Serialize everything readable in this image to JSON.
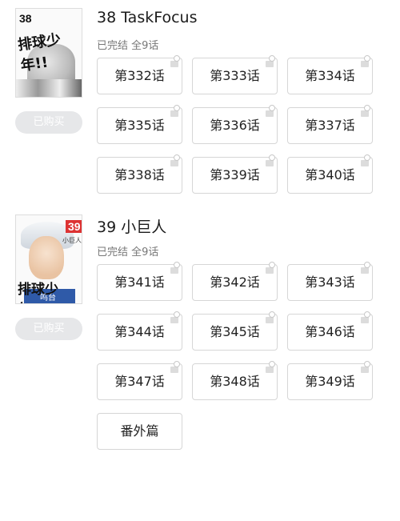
{
  "volumes": [
    {
      "title": "38 TaskFocus",
      "status": "已完结 全9话",
      "badge": "已购买",
      "cover": {
        "number": "38",
        "title_art": "排球少年!!"
      },
      "chapters": [
        "第332话",
        "第333话",
        "第334话",
        "第335话",
        "第336话",
        "第337话",
        "第338话",
        "第339话",
        "第340话"
      ]
    },
    {
      "title": "39 小巨人",
      "status": "已完结 全9话",
      "badge": "已购买",
      "cover": {
        "number": "39",
        "subtitle": "小巨人",
        "title_art": "排球少年!!",
        "shirt_label": "鸣台"
      },
      "chapters": [
        "第341话",
        "第342话",
        "第343话",
        "第344话",
        "第345话",
        "第346话",
        "第347话",
        "第348话",
        "第349话",
        "番外篇"
      ]
    }
  ],
  "icons": {
    "chapter_lock": "lock-icon"
  }
}
